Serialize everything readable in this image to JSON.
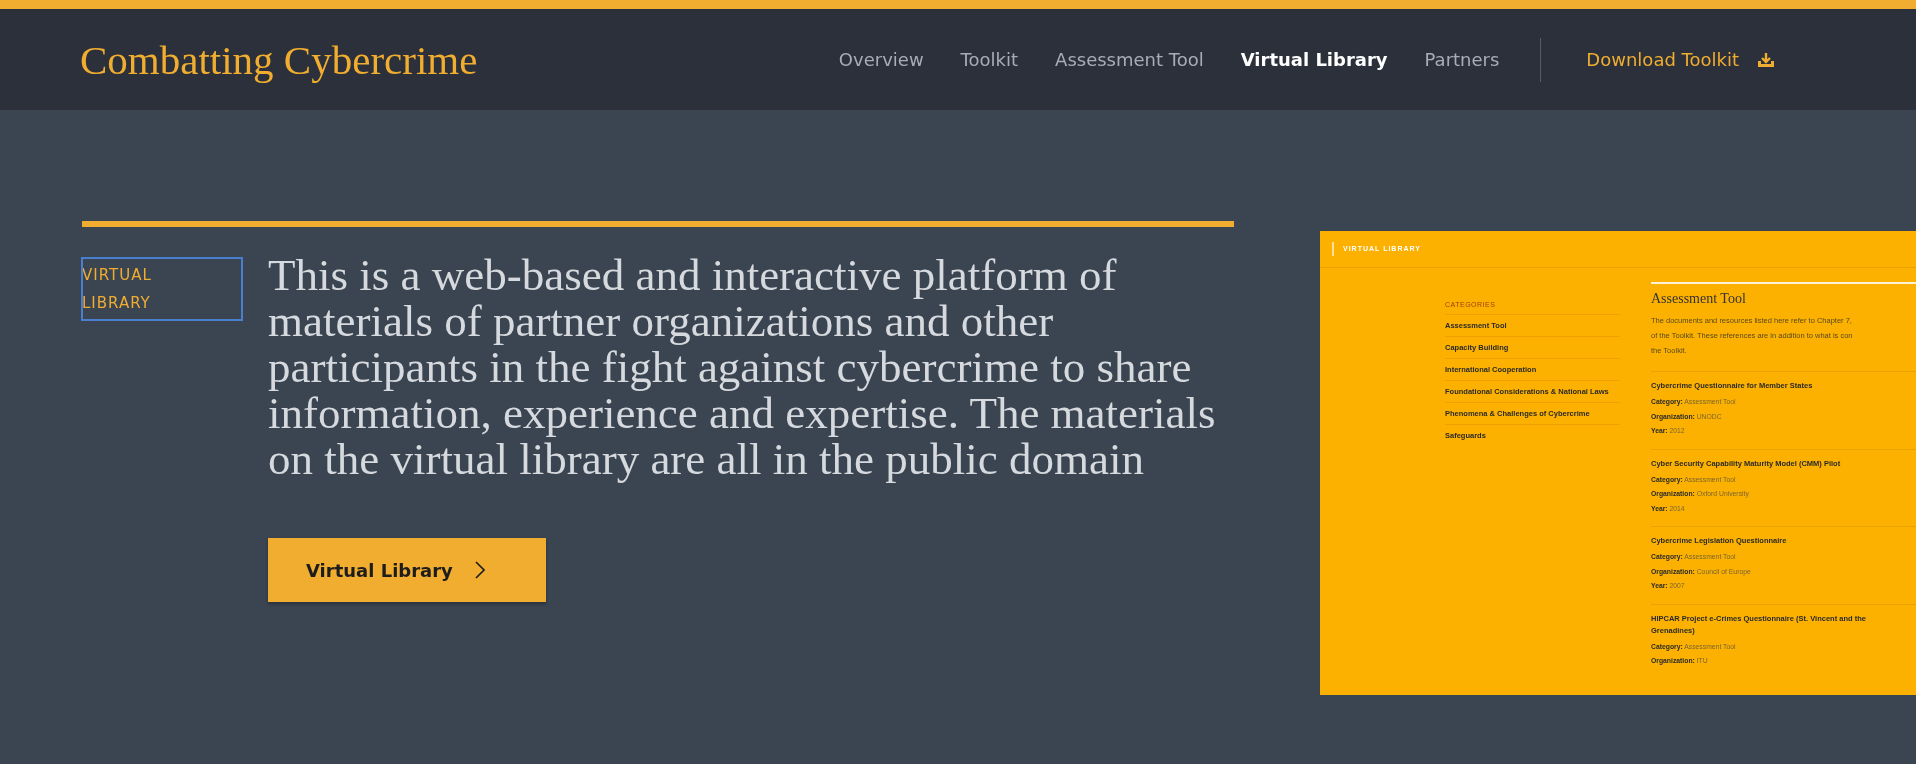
{
  "header": {
    "brand": "Combatting Cybercrime",
    "nav": [
      {
        "label": "Overview",
        "selected": false
      },
      {
        "label": "Toolkit",
        "selected": false
      },
      {
        "label": "Assessment Tool",
        "selected": false
      },
      {
        "label": "Virtual Library",
        "selected": true
      },
      {
        "label": "Partners",
        "selected": false
      }
    ],
    "download": "Download Toolkit"
  },
  "hero": {
    "section_label": {
      "text": "VIRTUAL LIBRARY",
      "focused": true
    },
    "description": "This is a web-based and interactive platform of materials of partner organizations and other participants in the fight against cybercrime to share information, experience and expertise. The materials on the virtual library are all in the public domain",
    "button": "Virtual Library"
  },
  "preview": {
    "header_title": "VIRTUAL LIBRARY",
    "categories_title": "CATEGORIES",
    "categories": [
      "Assessment Tool",
      "Capacity Building",
      "International Cooperation",
      "Foundational Considerations & National Laws",
      "Phenomena & Challenges of Cybercrime",
      "Safeguards"
    ],
    "heading": "Assessment Tool",
    "intro_lines": [
      "The documents and resources listed here refer to Chapter 7,",
      "of the Toolkit. These references are in addition to what is con",
      "the Toolkit."
    ],
    "entries": [
      {
        "title": "Cybercrime Questionnaire for Member States",
        "fields": [
          "**Category:** Assessment Tool",
          "**Organization:** UNODC",
          "**Year:** 2012"
        ]
      },
      {
        "title": "Cyber Security Capability Maturity Model (CMM) Pilot",
        "fields": [
          "**Category:** Assessment Tool",
          "**Organization:** Oxford University",
          "**Year:** 2014"
        ]
      },
      {
        "title": "Cybercrime Legislation Questionnaire",
        "fields": [
          "**Category:** Assessment Tool",
          "**Organization:** Council of Europe",
          "**Year:** 2007"
        ]
      },
      {
        "title": "HIPCAR Project e-Crimes Questionnaire (St. Vincent and the Grenadines)",
        "fields": [
          "**Category:** Assessment Tool",
          "**Organization:** ITU"
        ]
      }
    ]
  }
}
